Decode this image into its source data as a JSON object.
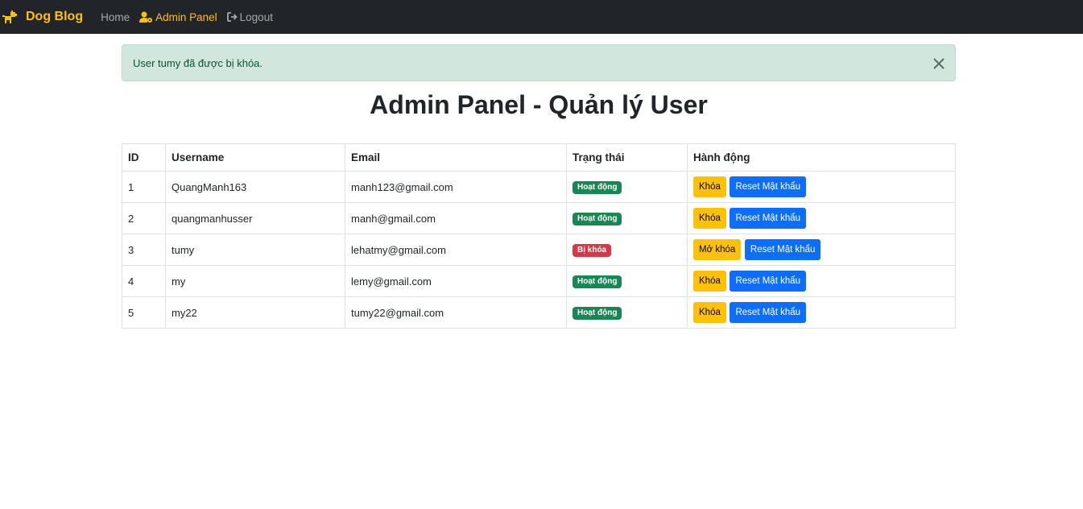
{
  "nav": {
    "brand": "Dog Blog",
    "links": [
      {
        "label": "Home"
      },
      {
        "label": "Admin Panel"
      },
      {
        "label": "Logout"
      }
    ]
  },
  "alert": {
    "message": "User tumy đã được bị khóa."
  },
  "page_title": "Admin Panel - Quản lý User",
  "table": {
    "headers": [
      "ID",
      "Username",
      "Email",
      "Trạng thái",
      "Hành động"
    ],
    "rows": [
      {
        "id": "1",
        "username": "QuangManh163",
        "email": "manh123@gmail.com",
        "status": "Hoạt động",
        "status_type": "active",
        "action": "Khóa",
        "reset": "Reset Mật khẩu"
      },
      {
        "id": "2",
        "username": "quangmanhusser",
        "email": "manh@gmail.com",
        "status": "Hoạt động",
        "status_type": "active",
        "action": "Khóa",
        "reset": "Reset Mật khẩu"
      },
      {
        "id": "3",
        "username": "tumy",
        "email": "lehatmy@gmail.com",
        "status": "Bị khóa",
        "status_type": "locked",
        "action": "Mở khóa",
        "reset": "Reset Mật khẩu"
      },
      {
        "id": "4",
        "username": "my",
        "email": "lemy@gmail.com",
        "status": "Hoạt động",
        "status_type": "active",
        "action": "Khóa",
        "reset": "Reset Mật khẩu"
      },
      {
        "id": "5",
        "username": "my22",
        "email": "tumy22@gmail.com",
        "status": "Hoạt động",
        "status_type": "active",
        "action": "Khóa",
        "reset": "Reset Mật khẩu"
      }
    ]
  },
  "colors": {
    "navbar": "#212529",
    "accent": "#ffc107",
    "success": "#198754",
    "danger": "#dc3545",
    "primary": "#0d6efd",
    "alert_bg": "#d1e7dd"
  },
  "icons": {
    "brand": "dog-icon",
    "admin": "user-gear-icon",
    "logout": "sign-out-icon",
    "close": "close-icon"
  }
}
